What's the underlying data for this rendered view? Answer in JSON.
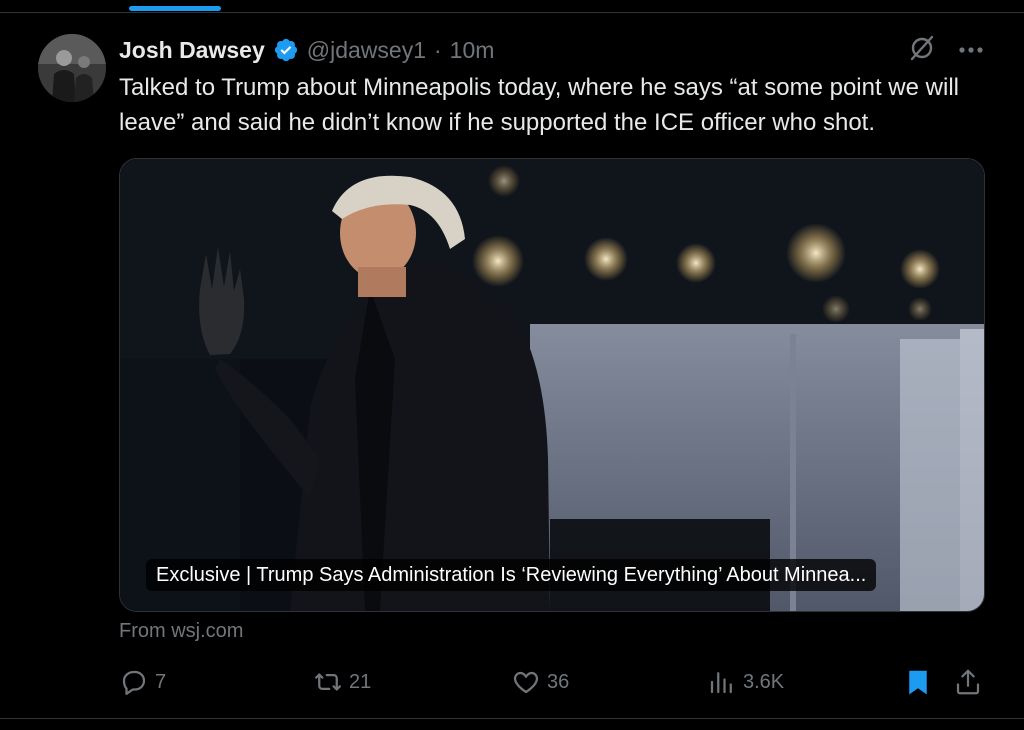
{
  "tweet": {
    "display_name": "Josh Dawsey",
    "handle": "@jdawsey1",
    "separator": "·",
    "time": "10m",
    "text": "Talked to Trump about Minneapolis today, where he says “at some point we will leave” and said he didn’t know if he supported the ICE officer who shot.",
    "media": {
      "caption": "Exclusive | Trump Says Administration Is ‘Reviewing Everything’ About Minnea..."
    },
    "source": "From wsj.com",
    "metrics": {
      "replies": "7",
      "reposts": "21",
      "likes": "36",
      "views": "3.6K"
    }
  },
  "icons": {
    "verified": "verified-badge-icon",
    "grok": "grok-icon",
    "more": "more-icon",
    "reply": "reply-icon",
    "repost": "repost-icon",
    "like": "heart-icon",
    "views": "views-icon",
    "bookmark": "bookmark-icon",
    "share": "share-icon"
  },
  "colors": {
    "accent": "#1d9bf0",
    "muted": "#71767b",
    "text": "#e7e9ea",
    "background": "#000000"
  }
}
